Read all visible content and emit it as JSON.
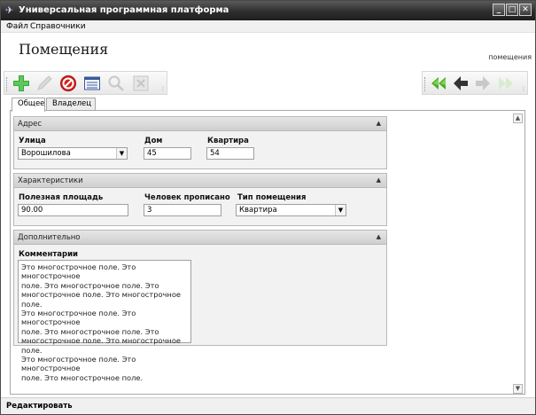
{
  "window": {
    "title": "Универсальная программная платформа",
    "app_icon": "bird-icon"
  },
  "menu": {
    "items": [
      "Файл",
      "Справочники"
    ]
  },
  "header": {
    "title": "Помещения",
    "breadcrumb": "помещения"
  },
  "toolbar": {
    "left": [
      "add-icon",
      "edit-icon",
      "delete-icon",
      "list-icon",
      "search-icon",
      "excel-icon"
    ],
    "right": [
      "first-icon",
      "prev-icon",
      "next-icon",
      "last-icon"
    ],
    "colors": {
      "add": "#3aa63a",
      "delete": "#d62020",
      "nav_active": "#4caf22",
      "nav_dark": "#333333",
      "disabled": "#c8c8c8"
    }
  },
  "tabs": [
    {
      "label": "Общее",
      "active": true
    },
    {
      "label": "Владелец",
      "active": false
    }
  ],
  "sections": {
    "address": {
      "title": "Адрес",
      "street": {
        "label": "Улица",
        "value": "Ворошилова"
      },
      "house": {
        "label": "Дом",
        "value": "45"
      },
      "apartment": {
        "label": "Квартира",
        "value": "54"
      }
    },
    "characteristics": {
      "title": "Характеристики",
      "area": {
        "label": "Полезная площадь",
        "value": "90.00"
      },
      "residents": {
        "label": "Человек прописано",
        "value": "3"
      },
      "type": {
        "label": "Тип помещения",
        "value": "Квартира"
      }
    },
    "extra": {
      "title": "Дополнительно",
      "comments": {
        "label": "Комментарии",
        "lines": [
          "Это многострочное поле. Это многострочное",
          "поле. Это многострочное поле. Это",
          "многострочное поле. Это многострочное поле.",
          "Это многострочное поле. Это многострочное",
          "поле. Это многострочное поле. Это",
          "многострочное поле. Это многострочное поле.",
          "Это многострочное поле. Это многострочное",
          "поле. Это многострочное поле."
        ]
      }
    }
  },
  "status": {
    "text": "Редактировать"
  }
}
